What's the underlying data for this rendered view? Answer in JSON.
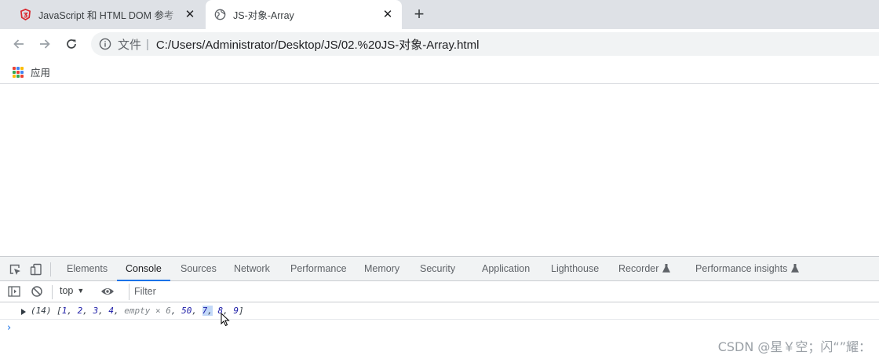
{
  "tabs": [
    {
      "title": "JavaScript 和 HTML DOM 参考",
      "favicon": "w3-icon",
      "active": false
    },
    {
      "title": "JS-对象-Array",
      "favicon": "globe-icon",
      "active": true
    }
  ],
  "toolbar": {
    "scheme_label": "文件",
    "separator": "|",
    "url": "C:/Users/Administrator/Desktop/JS/02.%20JS-对象-Array.html"
  },
  "bookmarks": {
    "apps_label": "应用"
  },
  "devtools": {
    "tabs": [
      {
        "label": "Elements",
        "active": false,
        "experimental": false
      },
      {
        "label": "Console",
        "active": true,
        "experimental": false
      },
      {
        "label": "Sources",
        "active": false,
        "experimental": false
      },
      {
        "label": "Network",
        "active": false,
        "experimental": false
      },
      {
        "label": "Performance",
        "active": false,
        "experimental": false
      },
      {
        "label": "Memory",
        "active": false,
        "experimental": false
      },
      {
        "label": "Security",
        "active": false,
        "experimental": false
      },
      {
        "label": "Application",
        "active": false,
        "experimental": false
      },
      {
        "label": "Lighthouse",
        "active": false,
        "experimental": false
      },
      {
        "label": "Recorder",
        "active": false,
        "experimental": true
      },
      {
        "label": "Performance insights",
        "active": false,
        "experimental": true
      }
    ],
    "context": "top",
    "filter_placeholder": "Filter",
    "console_output": {
      "length": "(14)",
      "open": "[",
      "items": [
        {
          "text": "1",
          "kind": "num"
        },
        {
          "text": "2",
          "kind": "num"
        },
        {
          "text": "3",
          "kind": "num"
        },
        {
          "text": "4",
          "kind": "num"
        },
        {
          "text": "empty × 6",
          "kind": "empty"
        },
        {
          "text": "50",
          "kind": "num"
        },
        {
          "text": "7",
          "kind": "num",
          "selected": true
        },
        {
          "text": "8",
          "kind": "num"
        },
        {
          "text": "9",
          "kind": "num"
        }
      ],
      "close": "]"
    },
    "prompt_symbol": "›"
  },
  "watermark": "CSDN @星￥空；闪“”耀：",
  "colors": {
    "accent": "#1a73e8",
    "tabstrip": "#dee1e6",
    "omnibox": "#f1f3f4",
    "number": "#1a1aa6"
  }
}
